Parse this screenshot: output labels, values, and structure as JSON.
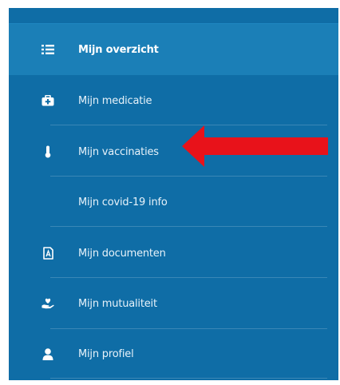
{
  "sidebar": {
    "items": [
      {
        "label": "Mijn overzicht",
        "icon": "list-icon",
        "active": true
      },
      {
        "label": "Mijn medicatie",
        "icon": "medkit-icon",
        "active": false
      },
      {
        "label": "Mijn vaccinaties",
        "icon": "thermometer-icon",
        "active": false
      },
      {
        "label": "Mijn covid-19 info",
        "icon": "",
        "active": false
      },
      {
        "label": "Mijn documenten",
        "icon": "pdf-file-icon",
        "active": false
      },
      {
        "label": "Mijn mutualiteit",
        "icon": "hand-heart-icon",
        "active": false
      },
      {
        "label": "Mijn profiel",
        "icon": "user-icon",
        "active": false
      }
    ]
  },
  "annotation": {
    "arrow_color": "#e8121a"
  },
  "colors": {
    "sidebar_bg": "#0f6da6",
    "active_bg": "#1b7fb7",
    "text": "#e7f2fa"
  }
}
